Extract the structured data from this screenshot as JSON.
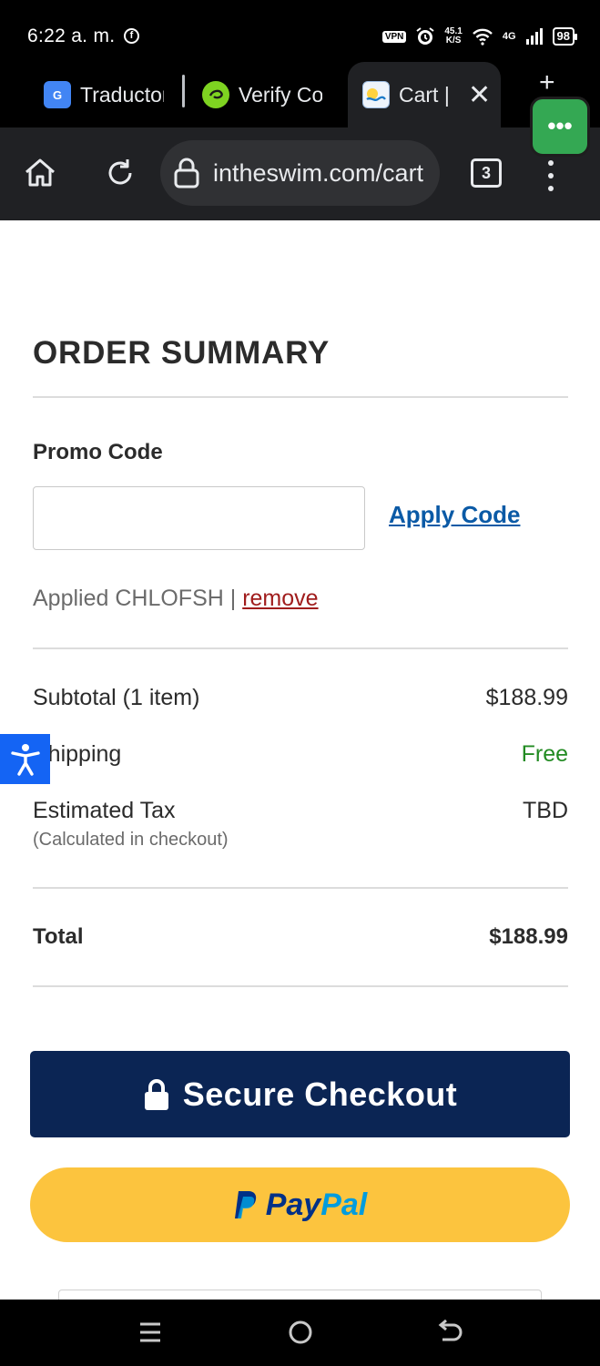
{
  "status_bar": {
    "time": "6:22 a. m.",
    "vpn": "VPN",
    "speed_value": "45.1",
    "speed_unit": "K/S",
    "network": "4G",
    "battery": "98"
  },
  "tabs": [
    {
      "label": "Traductor",
      "favicon": "google-translate-icon",
      "active": false
    },
    {
      "label": "Verify Code",
      "favicon": "verify-icon",
      "active": false
    },
    {
      "label": "Cart | InTheSwim",
      "favicon": "intheswim-icon",
      "active": true
    }
  ],
  "toolbar": {
    "url": "intheswim.com/cart",
    "tab_count": "3"
  },
  "order_summary": {
    "title": "ORDER SUMMARY",
    "promo_label": "Promo Code",
    "promo_value": "",
    "apply_label": "Apply Code",
    "applied_text": "Applied CHLOFSH",
    "applied_separator": " | ",
    "remove_label": "remove",
    "rows": {
      "subtotal_label": "Subtotal (1 item)",
      "subtotal_value": "$188.99",
      "shipping_label": "Shipping",
      "shipping_value": "Free",
      "tax_label": "Estimated Tax",
      "tax_value": "TBD",
      "tax_note": "(Calculated in checkout)"
    },
    "total_label": "Total",
    "total_value": "$188.99",
    "checkout_label": "Secure Checkout",
    "paypal_pay": "Pay",
    "paypal_pal": "Pal"
  },
  "colors": {
    "checkout_bg": "#0b2554",
    "paypal_bg": "#fcc43e",
    "link_blue": "#0b5aa6",
    "remove_red": "#a01d1d",
    "free_green": "#228b22",
    "accessibility_blue": "#1464f4"
  }
}
